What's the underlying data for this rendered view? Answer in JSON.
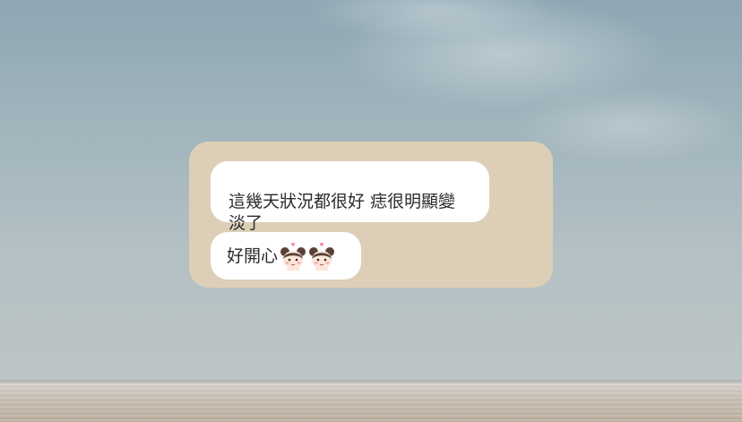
{
  "chat": {
    "messages": [
      {
        "text": "這幾天狀況都很好 痣很明顯變\n淡了"
      },
      {
        "text": "好開心",
        "stickers": [
          "girl-face-heart-icon",
          "girl-face-heart-icon"
        ]
      }
    ],
    "colors": {
      "card": "#ddcfb7",
      "bubble": "#ffffff",
      "text": "#2b2b2b"
    }
  }
}
